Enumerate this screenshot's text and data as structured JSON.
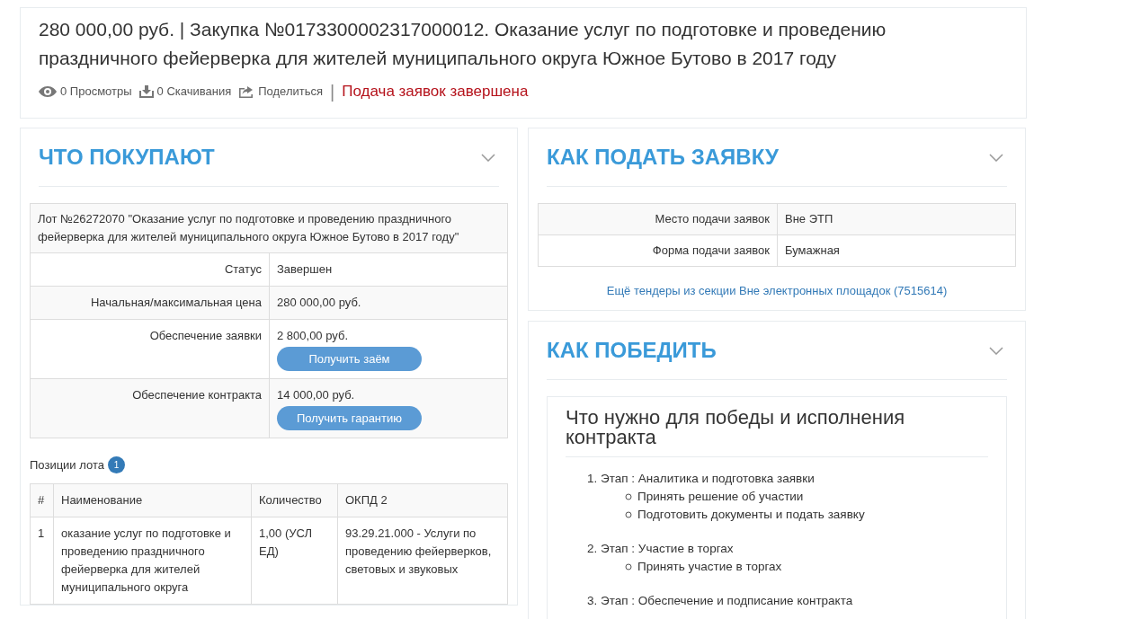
{
  "header": {
    "title": "280 000,00 руб. | Закупка №0173300002317000012. Оказание услуг по подготовке и проведению праздничного фейерверка для жителей муниципального округа Южное Бутово в 2017 году",
    "stats": [
      {
        "kind": "views",
        "text": "0 Просмотры"
      },
      {
        "kind": "downloads",
        "text": "0 Скачивания"
      },
      {
        "kind": "share",
        "text": "Поделиться"
      }
    ],
    "separator": "|",
    "status": "Подача заявок завершена"
  },
  "what_to_buy": {
    "title": "ЧТО ПОКУПАЮТ",
    "expanded": true,
    "lot_title": "Лот №26272070 \"Оказание услуг по подготовке и проведению праздничного фейерверка для жителей муниципального округа Южное Бутово в 2017 году\"",
    "rows": [
      {
        "label": "Статус",
        "value": "Завершен"
      },
      {
        "label": "Начальная/максимальная цена",
        "value": "280 000,00 руб."
      },
      {
        "label": "Обеспечение заявки",
        "value": "2 800,00 руб.",
        "button": "Получить заём"
      },
      {
        "label": "Обеспечение контракта",
        "value": "14 000,00 руб.",
        "button": "Получить гарантию"
      }
    ],
    "positions_label": "Позиции лота",
    "positions_count": "1",
    "columns": [
      "#",
      "Наименование",
      "Количество",
      "ОКПД 2"
    ],
    "items": [
      {
        "number": "1",
        "name": "оказание услуг по подготовке и проведению праздничного фейерверка для жителей муниципального округа",
        "quantity": "1,00 (УСЛ ЕД)",
        "okpd": "93.29.21.000 - Услуги по проведению фейерверков, световых и звуковых"
      }
    ]
  },
  "how_to_apply": {
    "title": "КАК ПОДАТЬ ЗАЯВКУ",
    "expanded": true,
    "rows": [
      {
        "label": "Место подачи заявок",
        "value": "Вне ЭТП"
      },
      {
        "label": "Форма подачи заявок",
        "value": "Бумажная"
      }
    ],
    "link": "Ещё тендеры из секции Вне электронных площадок (7515614)"
  },
  "how_to_win": {
    "title": "КАК ПОБЕДИТЬ",
    "expanded": true,
    "card_title": "Что нужно для победы и исполнения контракта",
    "stages": [
      {
        "text": "1. Этап : Аналитика и подготовка заявки",
        "children": [
          {
            "text": "Принять решение об участии"
          },
          {
            "text": "Подготовить документы и подать заявку"
          }
        ]
      },
      {
        "text": "2. Этап : Участие в торгах",
        "children": [
          {
            "text": "Принять участие в торгах"
          }
        ]
      },
      {
        "text": "3. Этап : Обеспечение и подписание контракта"
      }
    ]
  }
}
